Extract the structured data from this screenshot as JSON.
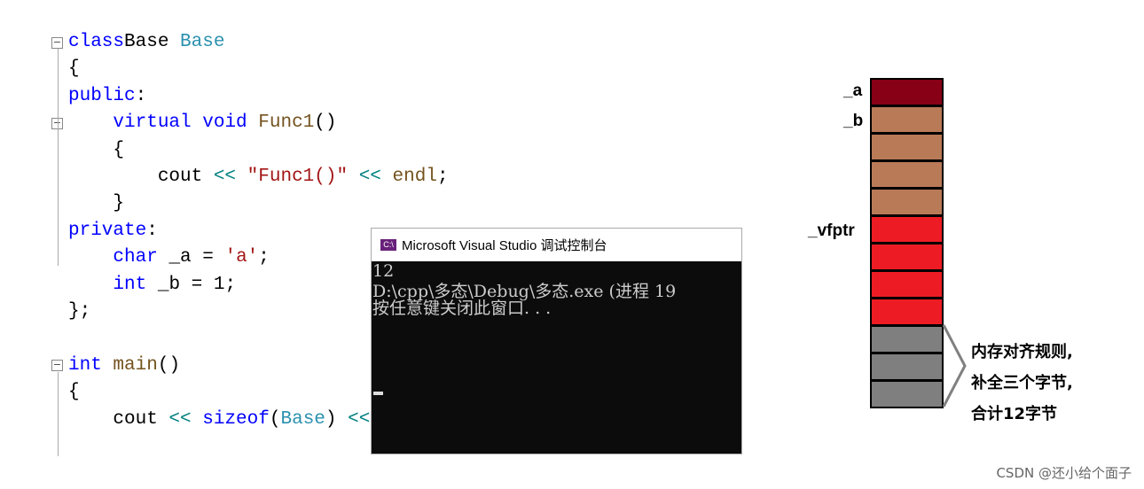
{
  "code": {
    "lines": [
      [
        [
          "kw",
          "class"
        ],
        [
          "",
          "Base "
        ],
        [
          "ty",
          "Base"
        ]
      ],
      [
        [
          "",
          "{"
        ]
      ],
      [
        [
          "kw",
          "public"
        ],
        [
          "",
          ":"
        ]
      ],
      [
        [
          "",
          "    "
        ],
        [
          "kw",
          "virtual"
        ],
        [
          "",
          " "
        ],
        [
          "kw",
          "void"
        ],
        [
          "",
          " "
        ],
        [
          "fn",
          "Func1"
        ],
        [
          "",
          "()"
        ]
      ],
      [
        [
          "",
          "    {"
        ]
      ],
      [
        [
          "",
          "        cout "
        ],
        [
          "op",
          "<<"
        ],
        [
          "",
          " "
        ],
        [
          "st",
          "\"Func1()\""
        ],
        [
          "",
          " "
        ],
        [
          "op",
          "<<"
        ],
        [
          "",
          " "
        ],
        [
          "fn",
          "endl"
        ],
        [
          "",
          ";"
        ]
      ],
      [
        [
          "",
          "    }"
        ]
      ],
      [
        [
          "kw",
          "private"
        ],
        [
          "",
          ":"
        ]
      ],
      [
        [
          "",
          "    "
        ],
        [
          "kw",
          "char"
        ],
        [
          "",
          " _a = "
        ],
        [
          "st",
          "'a'"
        ],
        [
          "",
          ";"
        ]
      ],
      [
        [
          "",
          "    "
        ],
        [
          "kw",
          "int"
        ],
        [
          "",
          " _b = 1;"
        ]
      ],
      [
        [
          "",
          "};"
        ]
      ],
      [
        [
          "",
          ""
        ]
      ],
      [
        [
          "kw",
          "int"
        ],
        [
          "",
          " "
        ],
        [
          "fn",
          "main"
        ],
        [
          "",
          "()"
        ]
      ],
      [
        [
          "",
          "{"
        ]
      ],
      [
        [
          "",
          "    cout "
        ],
        [
          "op",
          "<<"
        ],
        [
          "",
          " "
        ],
        [
          "kw",
          "sizeof"
        ],
        [
          "",
          "("
        ],
        [
          "ty",
          "Base"
        ],
        [
          "",
          ") "
        ],
        [
          "op",
          "<<"
        ]
      ]
    ]
  },
  "console": {
    "title": "Microsoft Visual Studio 调试控制台",
    "icon_text": "C:\\",
    "lines": [
      "12",
      "",
      "D:\\cpp\\多态\\Debug\\多态.exe (进程 19",
      "按任意键关闭此窗口. . ."
    ]
  },
  "memory": {
    "labels": [
      "_a",
      "_b",
      "_vfptr"
    ],
    "blocks": [
      "#870016",
      "#b97a57",
      "#b97a57",
      "#b97a57",
      "#b97a57",
      "#ed1c24",
      "#ed1c24",
      "#ed1c24",
      "#ed1c24",
      "#7f7f7f",
      "#7f7f7f",
      "#7f7f7f"
    ],
    "note": [
      "内存对齐规则,",
      "补全三个字节,",
      "合计12字节"
    ]
  },
  "watermark": "CSDN @还小给个面子"
}
